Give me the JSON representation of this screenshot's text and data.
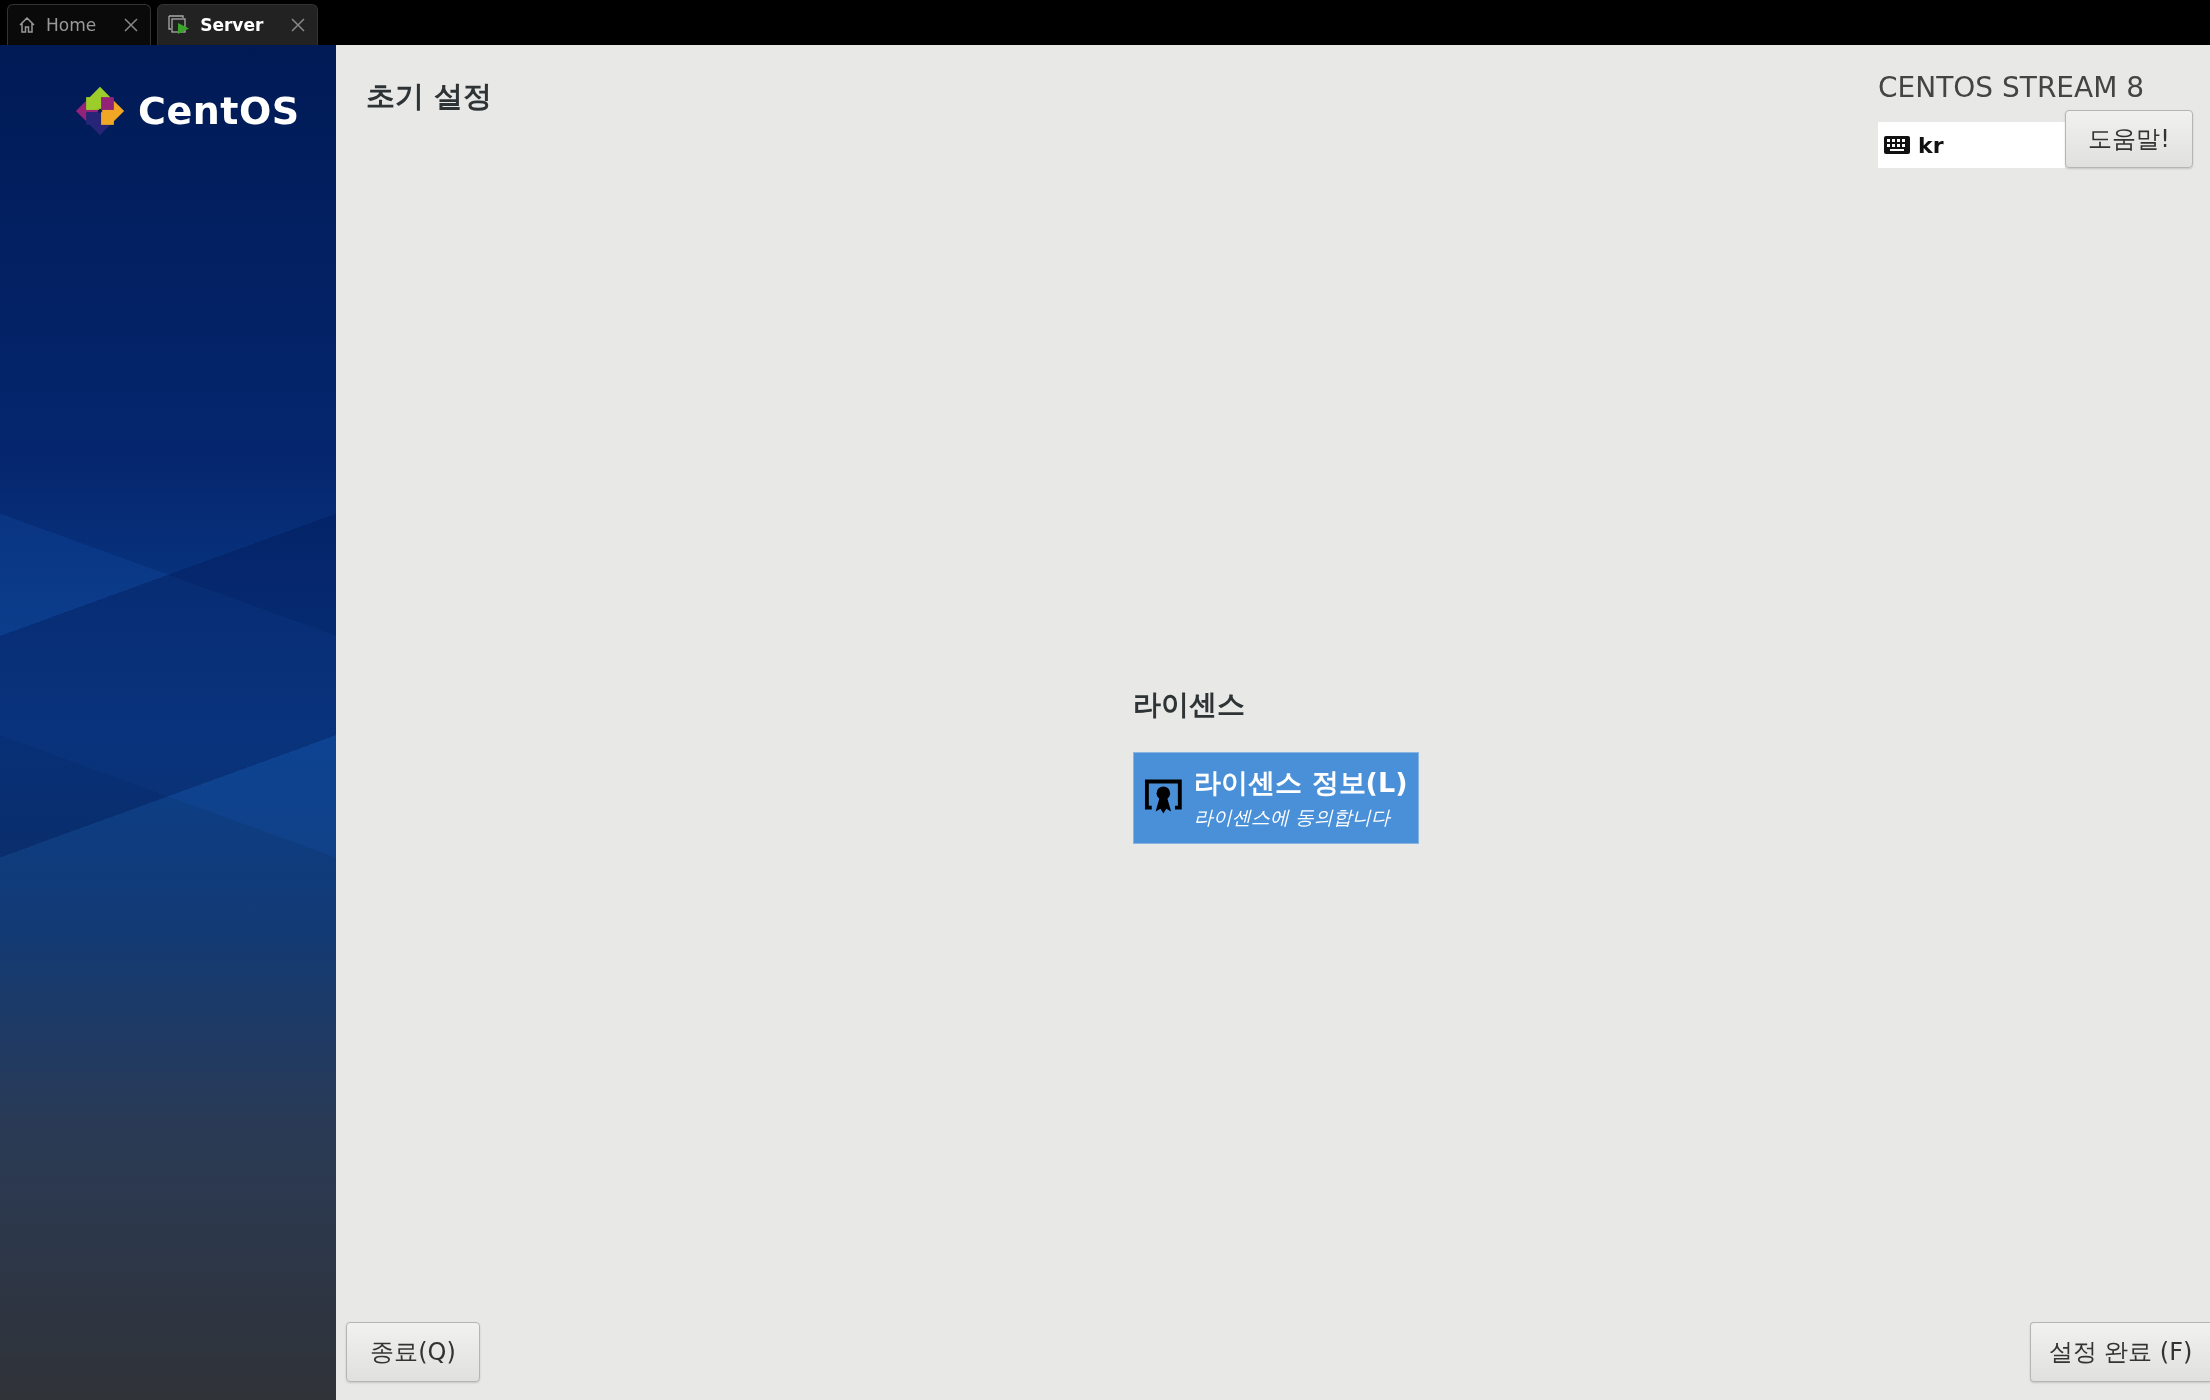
{
  "tabs": [
    {
      "label": "Home",
      "kind": "home",
      "selected": false
    },
    {
      "label": "Server",
      "kind": "vm",
      "selected": true
    }
  ],
  "sidebar": {
    "logo_text": "CentOS"
  },
  "header": {
    "title": "초기 설정",
    "product": "CENTOS STREAM 8",
    "keyboard_layout": "kr",
    "help_button": "도움말!"
  },
  "section": {
    "heading": "라이센스",
    "spokes": [
      {
        "title": "라이센스 정보(L)",
        "status": "라이센스에 동의합니다",
        "selected": true
      }
    ]
  },
  "footer": {
    "quit_button": "종료(Q)",
    "finish_button": "설정 완료 (F)"
  }
}
